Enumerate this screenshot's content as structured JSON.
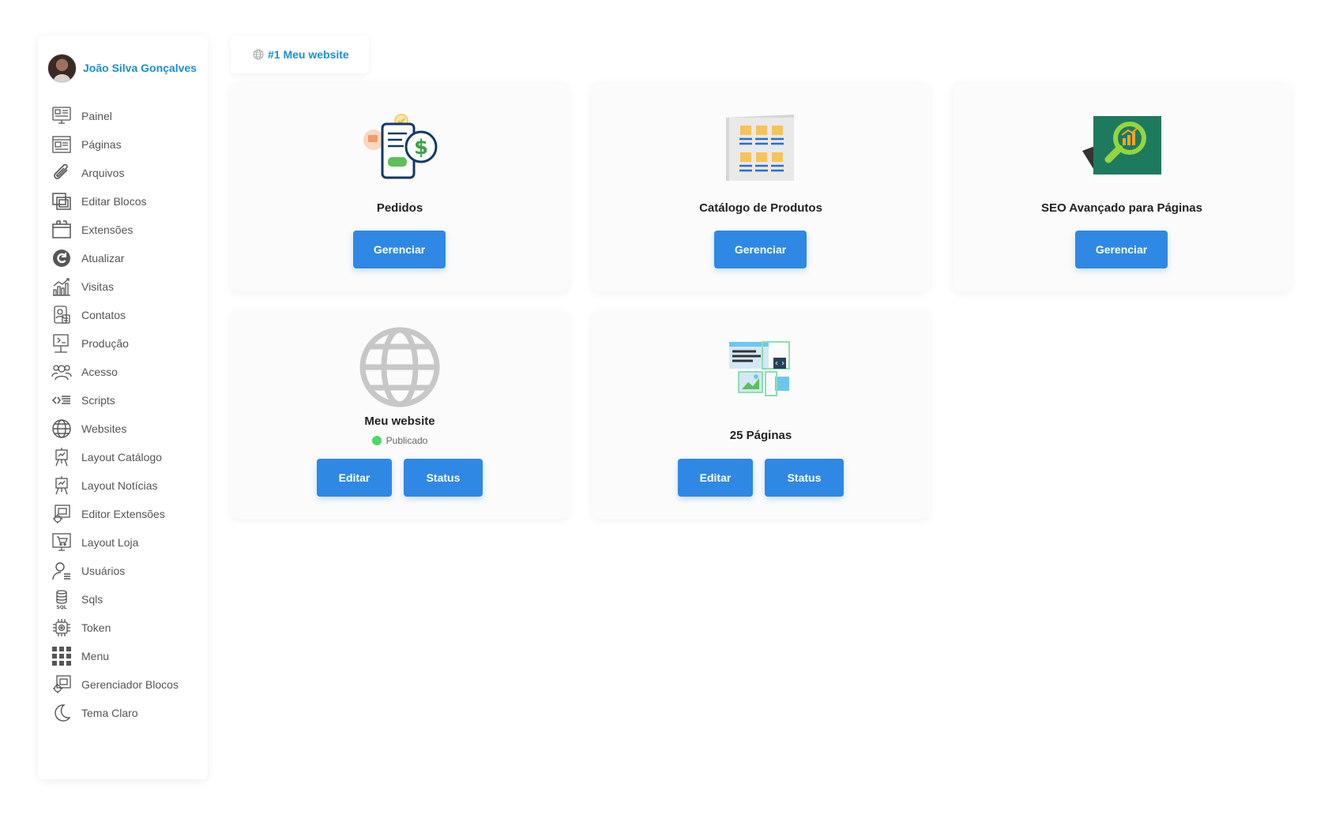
{
  "user": {
    "name": "João Silva Gonçalves"
  },
  "sidebar": {
    "items": [
      {
        "label": "Painel",
        "icon": "dashboard-icon"
      },
      {
        "label": "Páginas",
        "icon": "pages-icon"
      },
      {
        "label": "Arquivos",
        "icon": "paperclip-icon"
      },
      {
        "label": "Editar Blocos",
        "icon": "blocks-icon"
      },
      {
        "label": "Extensões",
        "icon": "extensions-icon"
      },
      {
        "label": "Atualizar",
        "icon": "refresh-icon"
      },
      {
        "label": "Visitas",
        "icon": "bar-chart-icon"
      },
      {
        "label": "Contatos",
        "icon": "contacts-icon"
      },
      {
        "label": "Produção",
        "icon": "production-icon"
      },
      {
        "label": "Acesso",
        "icon": "users-group-icon"
      },
      {
        "label": "Scripts",
        "icon": "code-icon"
      },
      {
        "label": "Websites",
        "icon": "globe-icon"
      },
      {
        "label": "Layout Catálogo",
        "icon": "easel-icon"
      },
      {
        "label": "Layout Notícias",
        "icon": "easel-icon"
      },
      {
        "label": "Editor Extensões",
        "icon": "gear-blocks-icon"
      },
      {
        "label": "Layout Loja",
        "icon": "cart-screen-icon"
      },
      {
        "label": "Usuários",
        "icon": "user-list-icon"
      },
      {
        "label": "Sqls",
        "icon": "database-icon"
      },
      {
        "label": "Token",
        "icon": "chip-icon"
      },
      {
        "label": "Menu",
        "icon": "grid-icon"
      },
      {
        "label": "Gerenciador Blocos",
        "icon": "gear-blocks-icon"
      },
      {
        "label": "Tema Claro",
        "icon": "moon-icon"
      }
    ]
  },
  "tab": {
    "label": "#1 Meu website",
    "icon": "globe-icon"
  },
  "cards": {
    "pedidos": {
      "title": "Pedidos",
      "button": "Gerenciar",
      "icon": "orders-payment-icon"
    },
    "catalogo": {
      "title": "Catálogo de Produtos",
      "button": "Gerenciar",
      "icon": "product-catalog-icon"
    },
    "seo": {
      "title": "SEO Avançado para Páginas",
      "button": "Gerenciar",
      "icon": "seo-search-icon"
    },
    "website": {
      "title": "Meu website",
      "status": "Publicado",
      "status_color": "#4cd964",
      "edit": "Editar",
      "status_button": "Status",
      "icon": "globe-icon"
    },
    "paginas": {
      "title": "25 Páginas",
      "edit": "Editar",
      "status_button": "Status",
      "icon": "web-pages-icon"
    }
  },
  "colors": {
    "accent": "#2f88e3",
    "link": "#1a8fd4"
  }
}
